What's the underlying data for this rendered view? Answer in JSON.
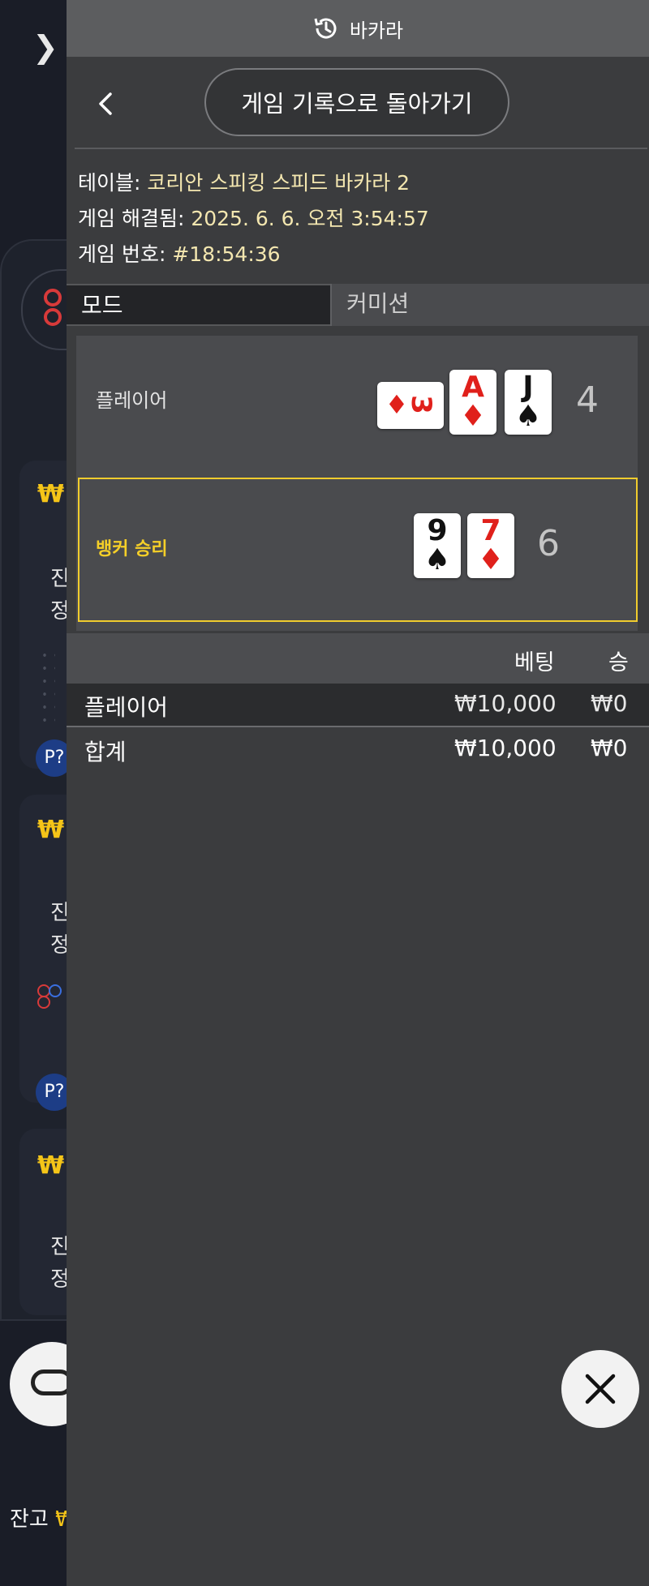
{
  "topbar": {
    "title": "바카라",
    "icon": "history-icon"
  },
  "nav": {
    "back_label": "게임 기록으로 돌아가기"
  },
  "info": {
    "table_label": "테이블: ",
    "table_value": "코리안 스피킹 스피드 바카라 2",
    "resolved_label": "게임 해결됨: ",
    "resolved_value": "2025. 6. 6. 오전 3:54:57",
    "number_label": "게임 번호: ",
    "number_value": "#18:54:36"
  },
  "tabs": {
    "mode": "모드",
    "commission": "커미션"
  },
  "result": {
    "player_label": "플레이어",
    "player_score": "4",
    "player_cards": [
      {
        "rank": "3",
        "suit": "♦",
        "color": "red",
        "orientation": "sideways"
      },
      {
        "rank": "A",
        "suit": "♦",
        "color": "red"
      },
      {
        "rank": "J",
        "suit": "♠",
        "color": "black"
      }
    ],
    "banker_label": "뱅커 승리",
    "banker_score": "6",
    "banker_cards": [
      {
        "rank": "9",
        "suit": "♠",
        "color": "black"
      },
      {
        "rank": "7",
        "suit": "♦",
        "color": "red"
      }
    ],
    "highlight_color": "#f0cc2d"
  },
  "bets": {
    "headers": {
      "bet": "베팅",
      "win": "승"
    },
    "rows": [
      {
        "label": "플레이어",
        "bet": "₩10,000",
        "win": "₩0"
      }
    ],
    "total": {
      "label": "합계",
      "bet": "₩10,000",
      "win": "₩0"
    }
  },
  "background": {
    "cards": [
      {
        "amount": "₩",
        "text_line1": "진",
        "text_line2": "정",
        "badge": "P?"
      },
      {
        "amount": "₩",
        "text_line1": "진",
        "text_line2": "정",
        "badge": "P?"
      },
      {
        "amount": "₩",
        "text_line1": "진",
        "text_line2": "정"
      }
    ],
    "balance_label": "잔고 ",
    "balance_value": "₩"
  }
}
